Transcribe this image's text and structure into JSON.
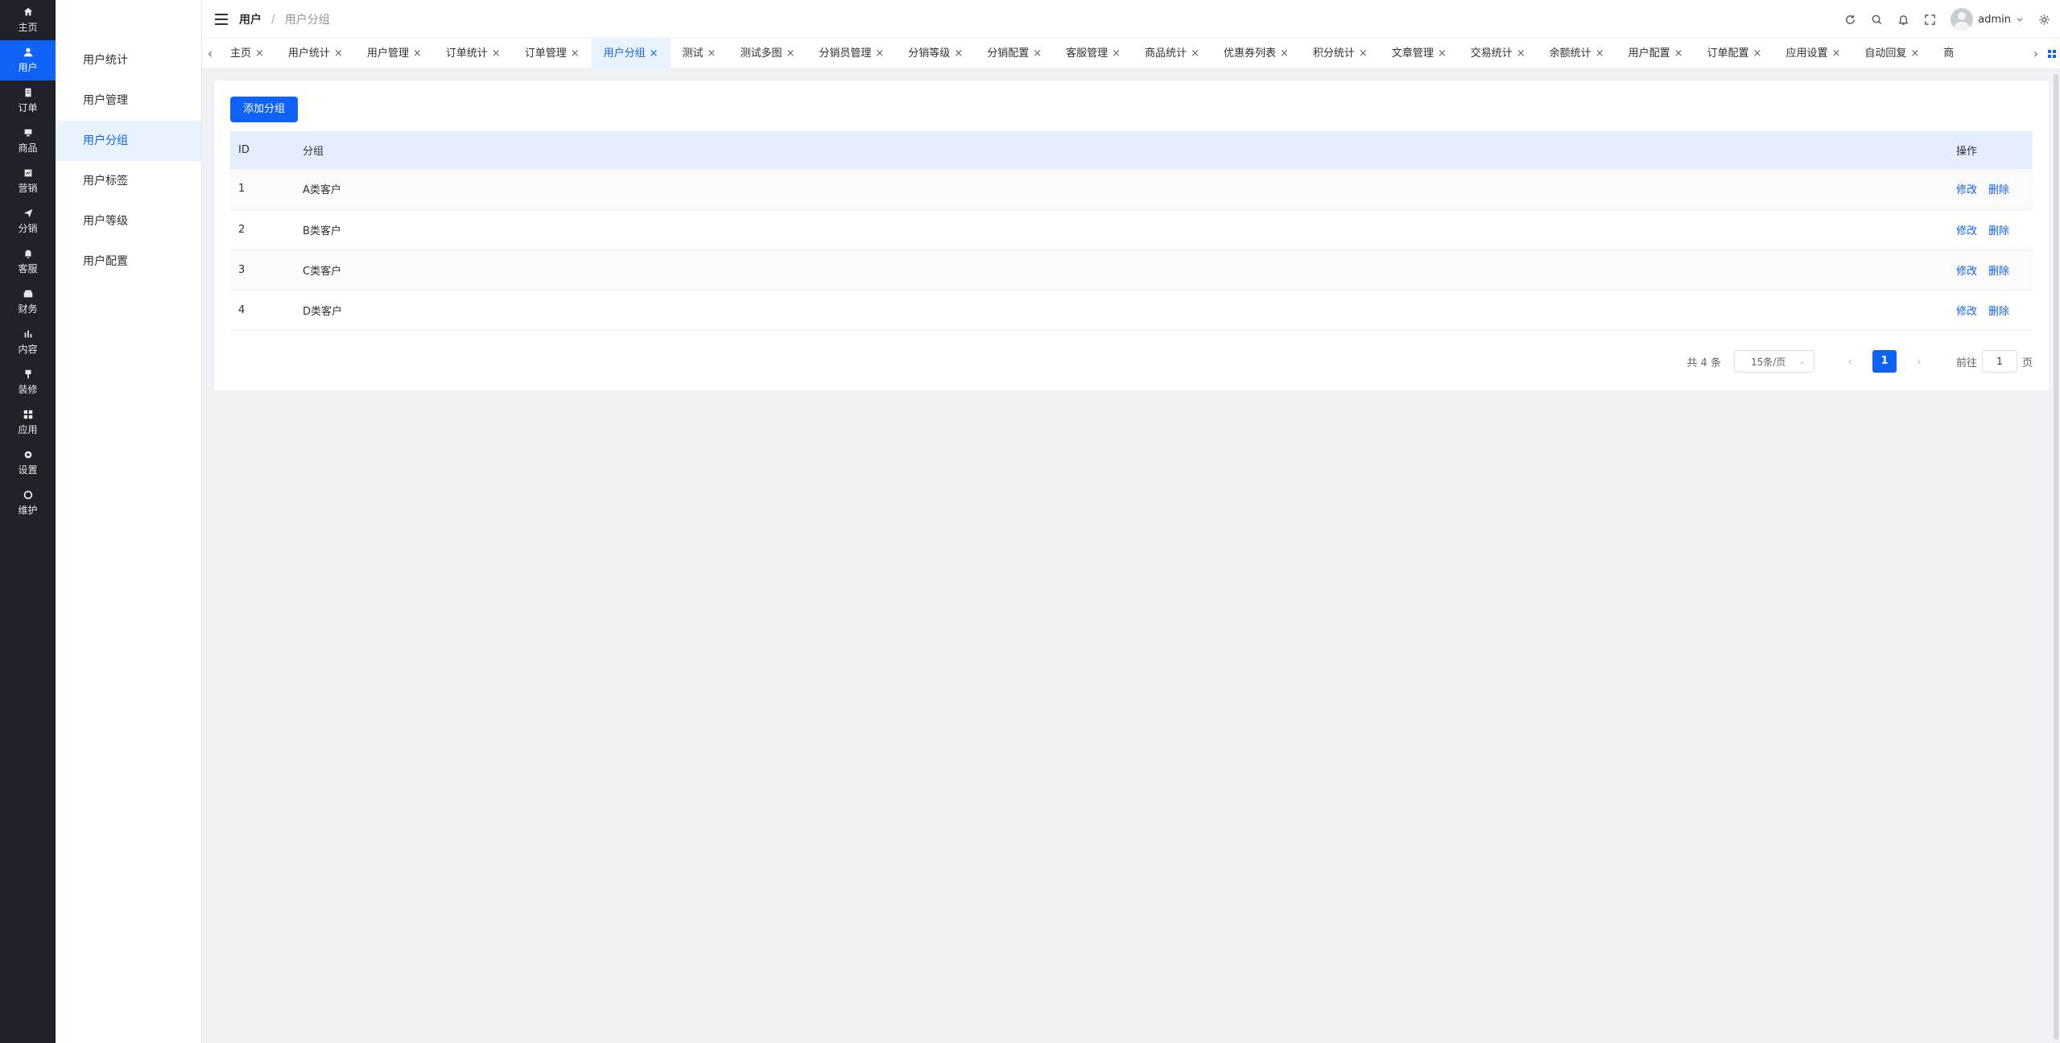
{
  "rail": {
    "items": [
      {
        "label": "主页",
        "icon": "home-icon"
      },
      {
        "label": "用户",
        "icon": "user-icon",
        "active": true
      },
      {
        "label": "订单",
        "icon": "order-icon"
      },
      {
        "label": "商品",
        "icon": "product-icon"
      },
      {
        "label": "营销",
        "icon": "marketing-icon"
      },
      {
        "label": "分销",
        "icon": "send-icon"
      },
      {
        "label": "客服",
        "icon": "bell-icon"
      },
      {
        "label": "财务",
        "icon": "finance-icon"
      },
      {
        "label": "内容",
        "icon": "chart-icon"
      },
      {
        "label": "装修",
        "icon": "brush-icon"
      },
      {
        "label": "应用",
        "icon": "apps-icon"
      },
      {
        "label": "设置",
        "icon": "settings-icon"
      },
      {
        "label": "维护",
        "icon": "maintain-icon"
      }
    ]
  },
  "submenu": {
    "items": [
      "用户统计",
      "用户管理",
      "用户分组",
      "用户标签",
      "用户等级",
      "用户配置"
    ],
    "active_index": 2
  },
  "header": {
    "breadcrumb_parent": "用户",
    "breadcrumb_sep": "/",
    "breadcrumb_current": "用户分组",
    "user_name": "admin"
  },
  "tabs": [
    "主页",
    "用户统计",
    "用户管理",
    "订单统计",
    "订单管理",
    "用户分组",
    "测试",
    "测试多图",
    "分销员管理",
    "分销等级",
    "分销配置",
    "客服管理",
    "商品统计",
    "优惠券列表",
    "积分统计",
    "文章管理",
    "交易统计",
    "余额统计",
    "用户配置",
    "订单配置",
    "应用设置",
    "自动回复",
    "商"
  ],
  "active_tab": "用户分组",
  "content": {
    "add_button": "添加分组",
    "columns": {
      "id": "ID",
      "group": "分组",
      "actions": "操作"
    },
    "rows": [
      {
        "id": "1",
        "group": "A类客户"
      },
      {
        "id": "2",
        "group": "B类客户"
      },
      {
        "id": "3",
        "group": "C类客户"
      },
      {
        "id": "4",
        "group": "D类客户"
      }
    ],
    "edit_label": "修改",
    "delete_label": "删除"
  },
  "pagination": {
    "total_text": "共 4 条",
    "page_size": "15条/页",
    "current_page": "1",
    "goto_label": "前往",
    "goto_value": "1",
    "page_unit": "页"
  },
  "colors": {
    "primary": "#1061f5",
    "rail_bg": "#1f2329",
    "header_row": "#e5eefe"
  }
}
